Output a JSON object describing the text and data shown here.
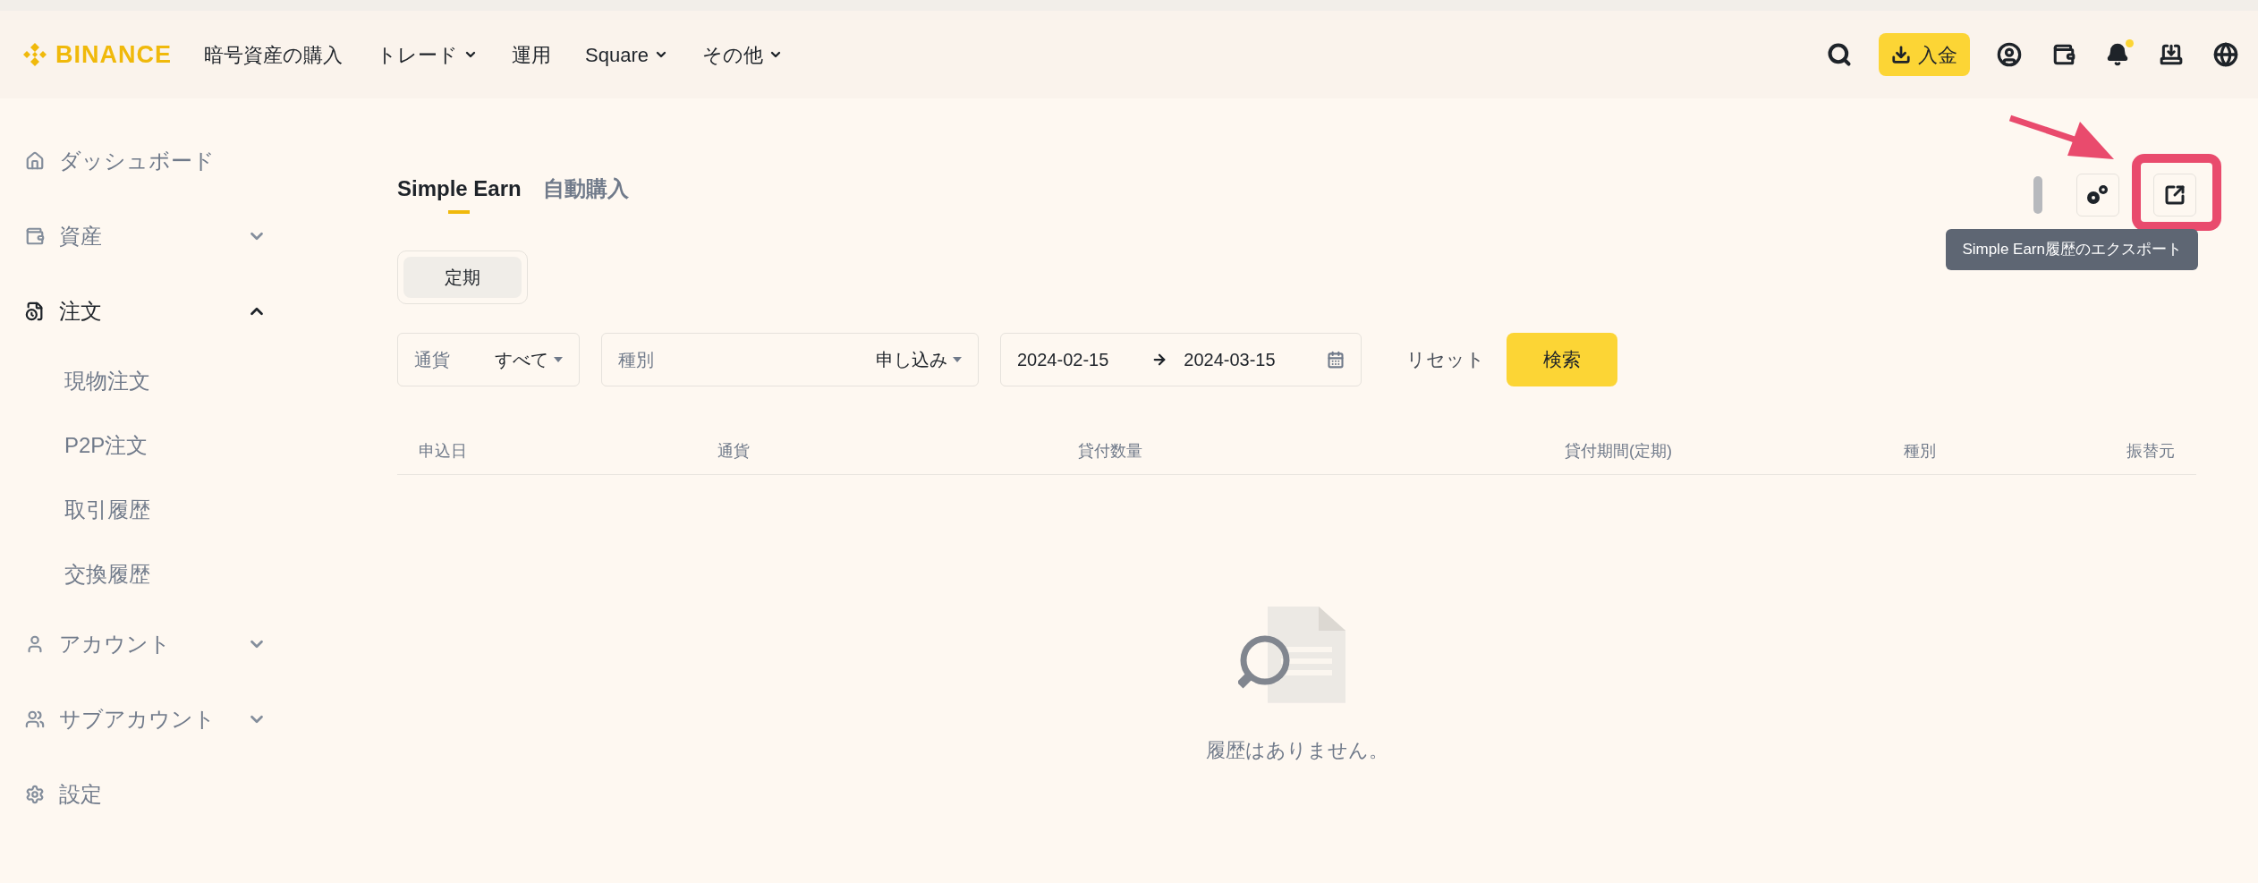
{
  "header": {
    "logo": "BINANCE",
    "nav": [
      {
        "label": "暗号資産の購入",
        "has_menu": false
      },
      {
        "label": "トレード",
        "has_menu": true
      },
      {
        "label": "運用",
        "has_menu": false
      },
      {
        "label": "Square",
        "has_menu": true
      },
      {
        "label": "その他",
        "has_menu": true
      }
    ],
    "deposit_button": "入金"
  },
  "sidebar": {
    "items": [
      {
        "label": "ダッシュボード"
      },
      {
        "label": "資産",
        "expanded": false
      },
      {
        "label": "注文",
        "expanded": true,
        "children": [
          {
            "label": "現物注文"
          },
          {
            "label": "P2P注文"
          },
          {
            "label": "取引履歴"
          },
          {
            "label": "交換履歴"
          }
        ]
      },
      {
        "label": "アカウント",
        "expanded": false
      },
      {
        "label": "サブアカウント",
        "expanded": false
      },
      {
        "label": "設定"
      }
    ]
  },
  "page": {
    "tabs": [
      {
        "label": "Simple Earn",
        "selected": true
      },
      {
        "label": "自動購入",
        "selected": false
      }
    ],
    "segments": [
      {
        "label": "定期",
        "selected": true
      }
    ],
    "filters": [
      {
        "label": "通貨",
        "value": "すべて"
      },
      {
        "label": "種別",
        "value": "申し込み"
      }
    ],
    "date_range": {
      "start": "2024-02-15",
      "end": "2024-03-15"
    },
    "reset_button": "リセット",
    "search_button": "検索",
    "table": {
      "columns": [
        "申込日",
        "通貨",
        "貸付数量",
        "貸付期間(定期)",
        "種別",
        "振替元"
      ]
    },
    "empty_message": "履歴はありません。",
    "tooltip": "Simple Earn履歴のエクスポート"
  }
}
